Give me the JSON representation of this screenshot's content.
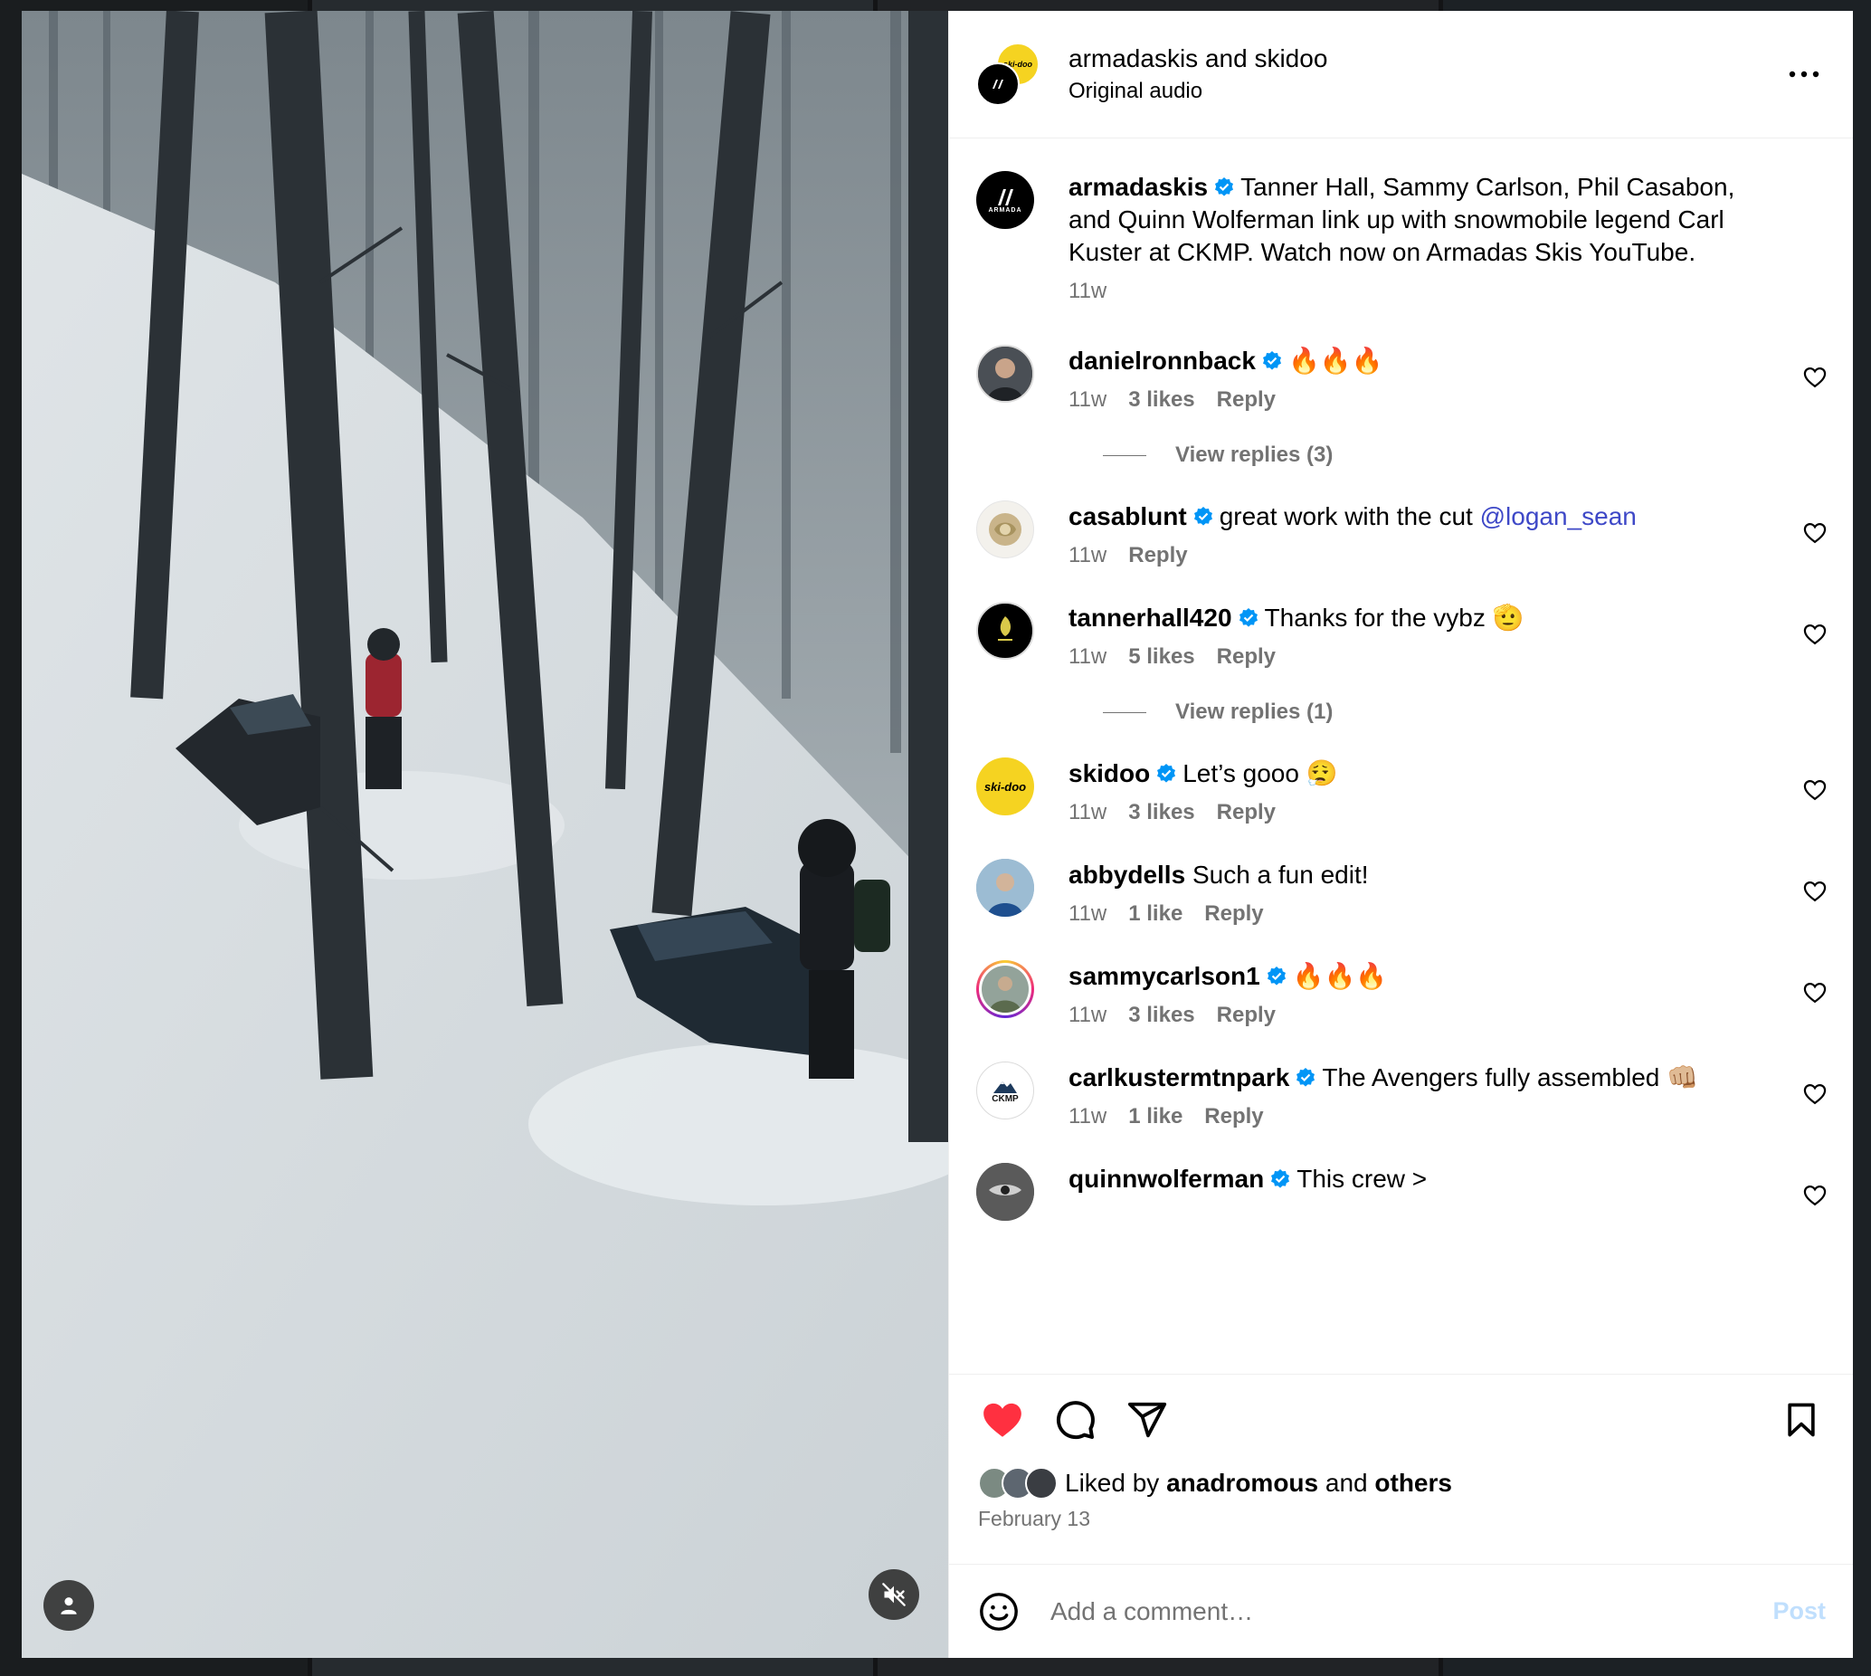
{
  "header": {
    "author_primary": "armadaskis",
    "joiner": "and",
    "author_secondary": "skidoo",
    "audio": "Original audio"
  },
  "caption": {
    "user": "armadaskis",
    "text": "Tanner Hall, Sammy Carlson, Phil Casabon, and Quinn Wolferman link up with snowmobile legend Carl Kuster at CKMP. Watch now on Armadas Skis YouTube.",
    "time": "11w"
  },
  "comments": [
    {
      "user": "danielronnback",
      "verified": true,
      "text": "🔥🔥🔥",
      "time": "11w",
      "likes": "3 likes",
      "reply": "Reply",
      "replies": "View replies (3)"
    },
    {
      "user": "casablunt",
      "verified": true,
      "text": "great work with the cut ",
      "mention": "@logan_sean",
      "time": "11w",
      "likes": "",
      "reply": "Reply"
    },
    {
      "user": "tannerhall420",
      "verified": true,
      "text": "Thanks for the vybz 🫡",
      "time": "11w",
      "likes": "5 likes",
      "reply": "Reply",
      "replies": "View replies (1)"
    },
    {
      "user": "skidoo",
      "verified": true,
      "text": "Let’s gooo 😮‍💨",
      "time": "11w",
      "likes": "3 likes",
      "reply": "Reply"
    },
    {
      "user": "abbydells",
      "verified": false,
      "text": "Such a fun edit!",
      "time": "11w",
      "likes": "1 like",
      "reply": "Reply"
    },
    {
      "user": "sammycarlson1",
      "verified": true,
      "text": "🔥🔥🔥",
      "time": "11w",
      "likes": "3 likes",
      "reply": "Reply"
    },
    {
      "user": "carlkustermtnpark",
      "verified": true,
      "text": "The Avengers fully assembled 👊🏼",
      "time": "11w",
      "likes": "1 like",
      "reply": "Reply"
    },
    {
      "user": "quinnwolferman",
      "verified": true,
      "text": "This crew >",
      "time": "",
      "likes": "",
      "reply": ""
    }
  ],
  "avatar_labels": {
    "armada": "ARMADA",
    "skidoo": "ski-doo",
    "ckmp": "CKMP"
  },
  "actions": {
    "liked_prefix": "Liked by ",
    "liked_user": "anadromous",
    "liked_joiner": " and ",
    "liked_others": "others",
    "date": "February 13"
  },
  "composer": {
    "placeholder": "Add a comment…",
    "post_label": "Post"
  },
  "icons": {
    "like": "heart-filled-icon",
    "comment": "comment-bubble-icon",
    "share": "paper-plane-icon",
    "save": "bookmark-icon",
    "more": "more-horizontal-icon",
    "mute": "speaker-muted-icon",
    "tags": "user-tag-icon",
    "emoji": "emoji-smile-icon"
  },
  "colors": {
    "like_red": "#ff3040",
    "verified_blue": "#0095f6",
    "mention": "#3e48c7",
    "secondary_text": "#737373",
    "post_disabled": "#c0dffd"
  }
}
